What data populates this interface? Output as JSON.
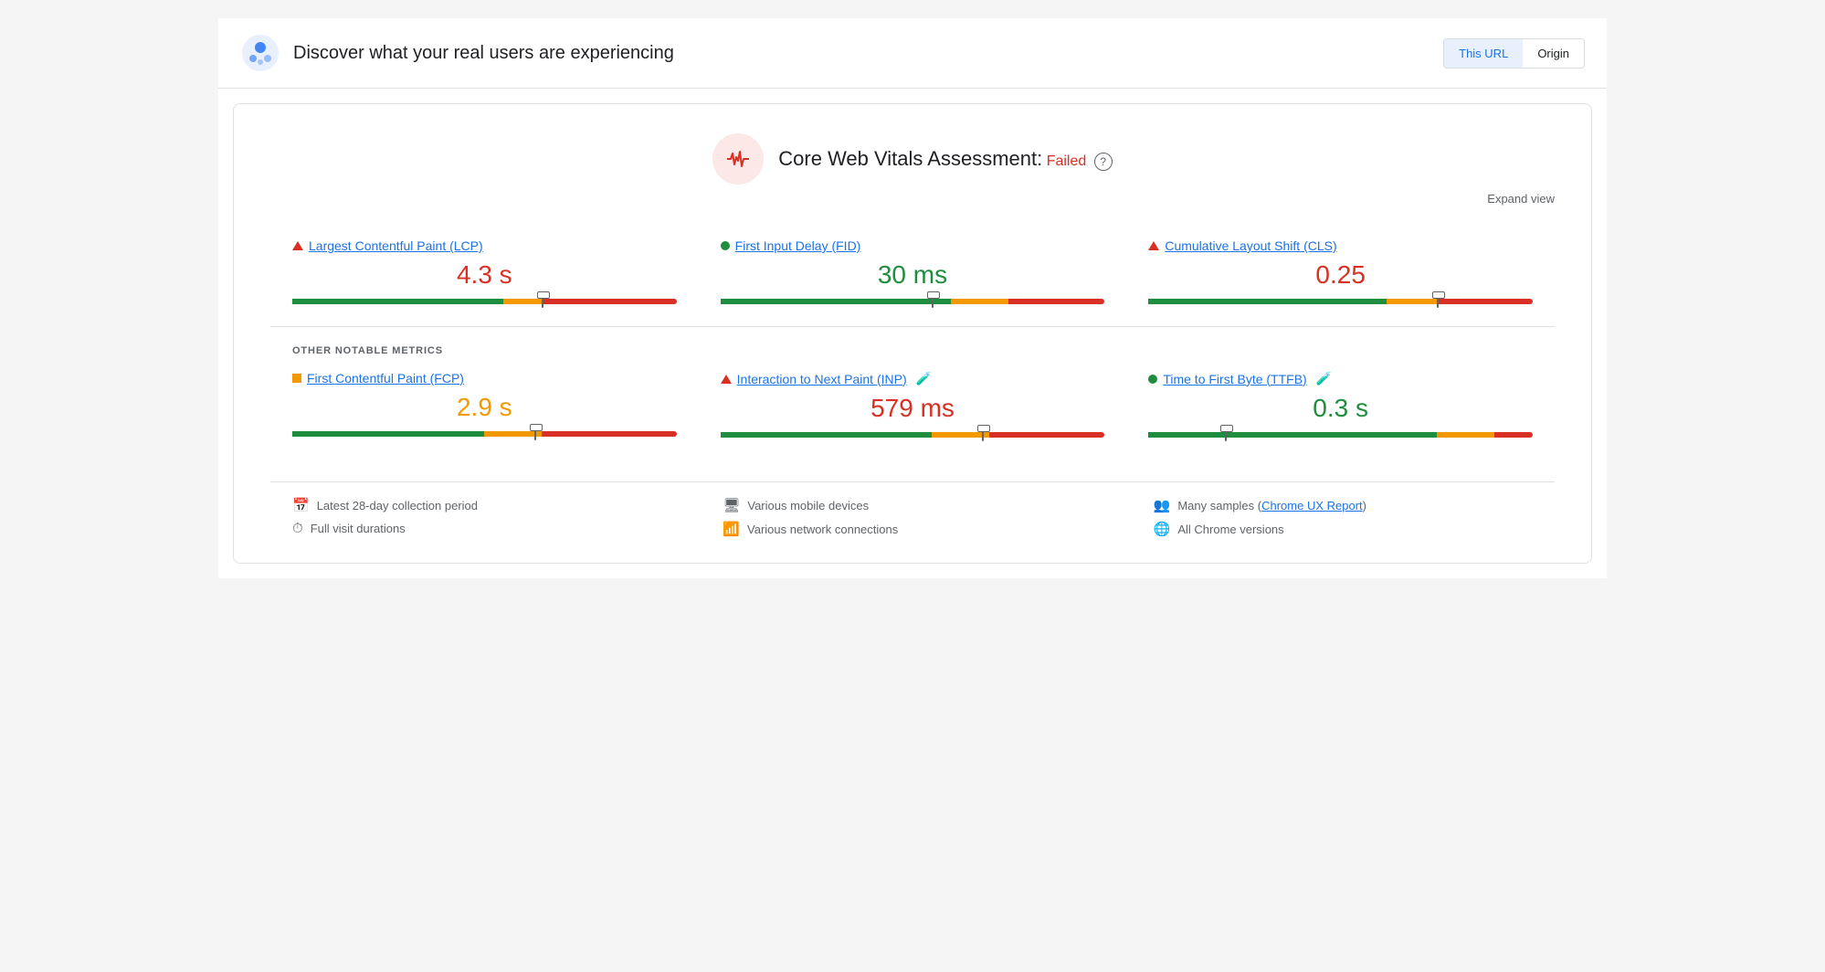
{
  "header": {
    "title": "Discover what your real users are experiencing",
    "this_url_label": "This URL",
    "origin_label": "Origin"
  },
  "assessment": {
    "title": "Core Web Vitals Assessment:",
    "status": "Failed",
    "expand_label": "Expand view"
  },
  "core_metrics": [
    {
      "id": "lcp",
      "status": "red_triangle",
      "label": "Largest Contentful Paint (LCP)",
      "value": "4.3 s",
      "value_color": "red",
      "gauge": {
        "green": 55,
        "orange": 10,
        "red": 35,
        "marker_pct": 65
      }
    },
    {
      "id": "fid",
      "status": "green_dot",
      "label": "First Input Delay (FID)",
      "value": "30 ms",
      "value_color": "green",
      "gauge": {
        "green": 60,
        "orange": 15,
        "red": 25,
        "marker_pct": 55
      }
    },
    {
      "id": "cls",
      "status": "red_triangle",
      "label": "Cumulative Layout Shift (CLS)",
      "value": "0.25",
      "value_color": "red",
      "gauge": {
        "green": 62,
        "orange": 13,
        "red": 25,
        "marker_pct": 75
      }
    }
  ],
  "other_metrics_label": "OTHER NOTABLE METRICS",
  "other_metrics": [
    {
      "id": "fcp",
      "status": "orange_square",
      "label": "First Contentful Paint (FCP)",
      "value": "2.9 s",
      "value_color": "orange",
      "experimental": false,
      "gauge": {
        "green": 50,
        "orange": 15,
        "red": 35,
        "marker_pct": 63
      }
    },
    {
      "id": "inp",
      "status": "red_triangle",
      "label": "Interaction to Next Paint (INP)",
      "value": "579 ms",
      "value_color": "red",
      "experimental": true,
      "gauge": {
        "green": 55,
        "orange": 15,
        "red": 30,
        "marker_pct": 68
      }
    },
    {
      "id": "ttfb",
      "status": "green_dot",
      "label": "Time to First Byte (TTFB)",
      "value": "0.3 s",
      "value_color": "green",
      "experimental": true,
      "gauge": {
        "green": 75,
        "orange": 15,
        "red": 10,
        "marker_pct": 20
      }
    }
  ],
  "footer": {
    "col1": [
      {
        "icon": "📅",
        "text": "Latest 28-day collection period"
      },
      {
        "icon": "⏱",
        "text": "Full visit durations"
      }
    ],
    "col2": [
      {
        "icon": "🖥",
        "text": "Various mobile devices"
      },
      {
        "icon": "📶",
        "text": "Various network connections"
      }
    ],
    "col3": [
      {
        "icon": "👥",
        "text": "Many samples (",
        "link": "Chrome UX Report",
        "text_after": ")"
      },
      {
        "icon": "🌐",
        "text": "All Chrome versions"
      }
    ]
  }
}
